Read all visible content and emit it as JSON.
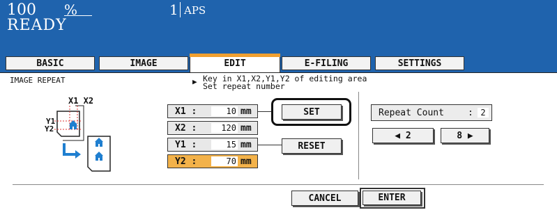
{
  "status": {
    "zoom_value": "100",
    "zoom_unit": "%",
    "copies": "1",
    "paper_mode": "APS",
    "state": "READY"
  },
  "tabs": [
    {
      "label": "BASIC",
      "active": false
    },
    {
      "label": "IMAGE",
      "active": false
    },
    {
      "label": "EDIT",
      "active": true
    },
    {
      "label": "E-FILING",
      "active": false
    },
    {
      "label": "SETTINGS",
      "active": false
    }
  ],
  "function_title": "IMAGE REPEAT",
  "instruction": {
    "line1": "Key in X1,X2,Y1,Y2 of editing area",
    "line2": "Set repeat number"
  },
  "diagram": {
    "x_labels": "X1 X2",
    "y1_label": "Y1",
    "y2_label": "Y2"
  },
  "fields": [
    {
      "label": "X1 :",
      "value": "10",
      "unit": "mm",
      "selected": false
    },
    {
      "label": "X2 :",
      "value": "120",
      "unit": "mm",
      "selected": false
    },
    {
      "label": "Y1 :",
      "value": "15",
      "unit": "mm",
      "selected": false
    },
    {
      "label": "Y2 :",
      "value": "70",
      "unit": "mm",
      "selected": true
    }
  ],
  "buttons": {
    "set": "SET",
    "reset": "RESET",
    "cancel": "CANCEL",
    "enter": "ENTER"
  },
  "repeat": {
    "label": "Repeat Count",
    "separator": ":",
    "value": "2",
    "dec_label": "◀ 2",
    "inc_label": "8 ▶"
  },
  "colors": {
    "header_blue": "#1f63ad",
    "active_tab_stripe": "#f0a030",
    "selected_field": "#f3b24a"
  }
}
